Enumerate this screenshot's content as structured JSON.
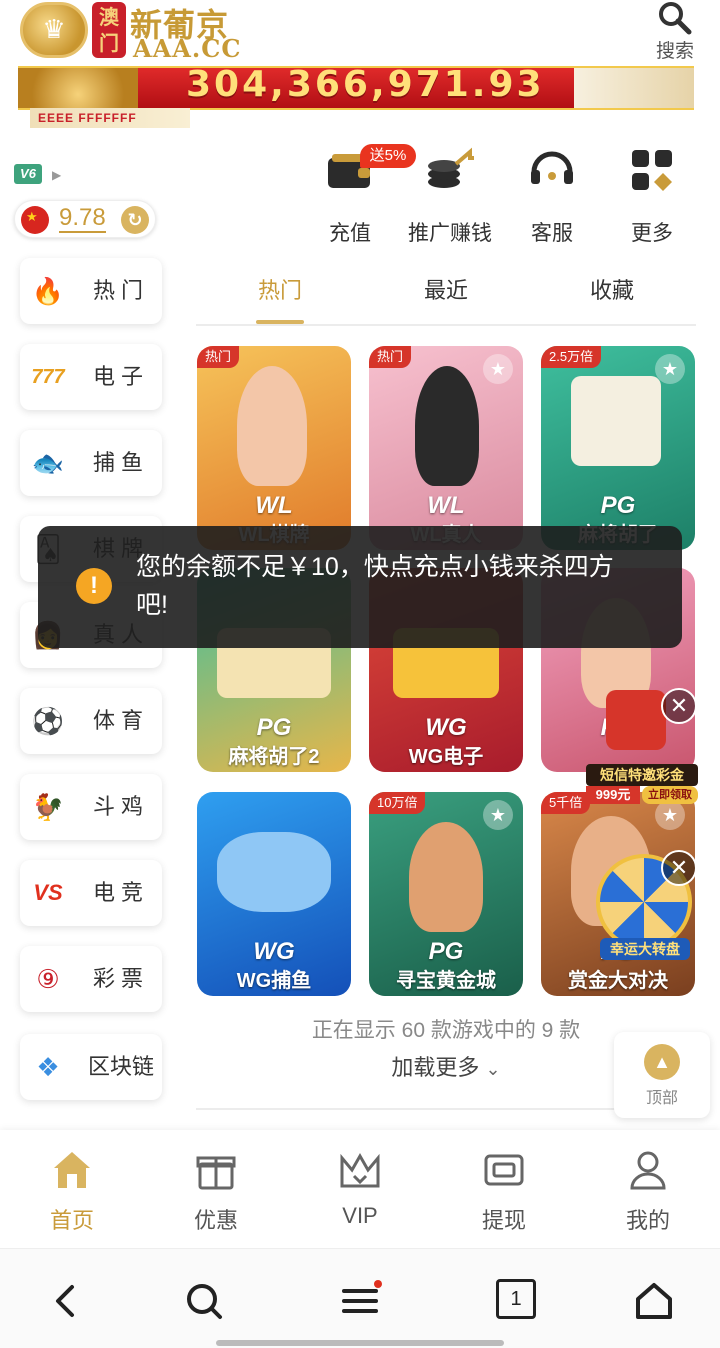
{
  "header": {
    "logo_red_text": "澳门",
    "logo_name": "新葡京",
    "logo_domain": "AAA.CC",
    "search_label": "搜索"
  },
  "banner": {
    "jackpot_value": "304,366,971.93",
    "sub_text": "EEEE FFFFFFF"
  },
  "user": {
    "vip_level": "V6",
    "balance": "9.78"
  },
  "quick_actions": [
    {
      "label": "充值",
      "icon": "wallet-icon",
      "tag": "送5%"
    },
    {
      "label": "推广赚钱",
      "icon": "coins-share-icon"
    },
    {
      "label": "客服",
      "icon": "headset-icon"
    },
    {
      "label": "更多",
      "icon": "grid-more-icon"
    }
  ],
  "categories": [
    {
      "label": "热门",
      "icon": "fire-icon"
    },
    {
      "label": "电子",
      "icon": "slot-777-icon"
    },
    {
      "label": "捕鱼",
      "icon": "fish-icon"
    },
    {
      "label": "棋牌",
      "icon": "cards-icon"
    },
    {
      "label": "真人",
      "icon": "dealer-icon"
    },
    {
      "label": "体育",
      "icon": "soccer-ball-icon"
    },
    {
      "label": "斗鸡",
      "icon": "rooster-icon"
    },
    {
      "label": "电竞",
      "icon": "vs-icon"
    },
    {
      "label": "彩票",
      "icon": "lottery-balls-icon"
    },
    {
      "label": "区块链",
      "icon": "blockchain-cubes-icon"
    }
  ],
  "tabs": [
    {
      "label": "热门",
      "active": true
    },
    {
      "label": "最近",
      "active": false
    },
    {
      "label": "收藏",
      "active": false
    }
  ],
  "games": [
    {
      "tag": "热门",
      "brand": "WL",
      "name": "WL棋牌",
      "color": "#f2a43a"
    },
    {
      "tag": "热门",
      "brand": "WL",
      "name": "WL真人",
      "color": "#f2a3b6"
    },
    {
      "tag": "2.5万倍",
      "brand": "PG",
      "name": "麻将胡了",
      "color": "#2fa58f"
    },
    {
      "tag": "",
      "brand": "PG",
      "name": "麻将胡了2",
      "color": "#2fa58f"
    },
    {
      "tag": "",
      "brand": "WG",
      "name": "WG电子",
      "color": "#d9382e"
    },
    {
      "tag": "",
      "brand": "PG",
      "name": "",
      "color": "#e25b8a"
    },
    {
      "tag": "",
      "brand": "WG",
      "name": "WG捕鱼",
      "color": "#1f6fd9"
    },
    {
      "tag": "10万倍",
      "brand": "PG",
      "name": "寻宝黄金城",
      "color": "#2a8f78"
    },
    {
      "tag": "5千倍",
      "brand": "PG",
      "name": "赏金大对决",
      "color": "#b8683a"
    }
  ],
  "toast": {
    "message": "您的余额不足￥10，快点充点小钱来杀四方吧!"
  },
  "floating": {
    "mail_label": "短信特邀彩金",
    "mail_amount": "999元",
    "mail_claim": "立即领取",
    "wheel_label": "幸运大转盘"
  },
  "list_footer": {
    "showing_text": "正在显示 60 款游戏中的 9 款",
    "load_more_label": "加载更多",
    "top_label": "顶部"
  },
  "bottom_nav": [
    {
      "label": "首页",
      "icon": "home-icon",
      "active": true
    },
    {
      "label": "优惠",
      "icon": "gift-icon",
      "active": false
    },
    {
      "label": "VIP",
      "icon": "vip-crown-icon",
      "active": false
    },
    {
      "label": "提现",
      "icon": "withdraw-ticket-icon",
      "active": false
    },
    {
      "label": "我的",
      "icon": "user-icon",
      "active": false
    }
  ],
  "browser_bar": {
    "tab_count": "1"
  },
  "colors": {
    "accent_gold": "#c99b3a",
    "banner_red": "#c8202a",
    "toast_bg": "#1e1e1e"
  }
}
